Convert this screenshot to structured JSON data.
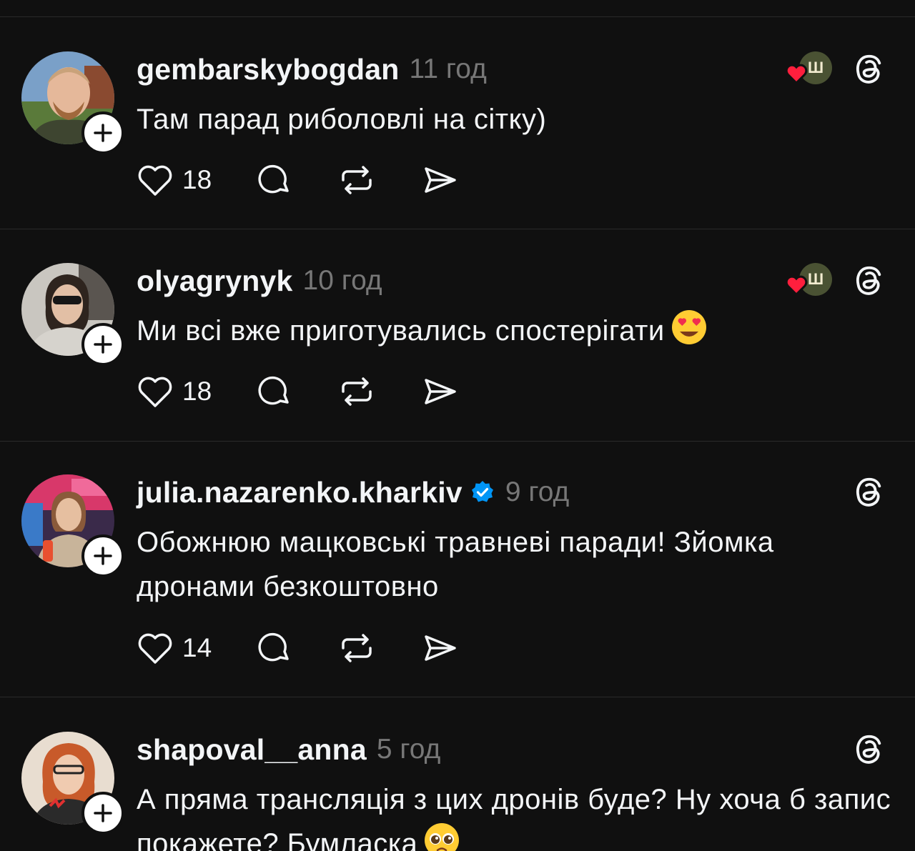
{
  "posts": [
    {
      "username": "gembarskybogdan",
      "time": "11 год",
      "text": "Там парад риболовлі на сітку)",
      "likes": "18",
      "verified": false,
      "liked_by_avatar": true,
      "liked_by_mark": "Ш"
    },
    {
      "username": "olyagrynyk",
      "time": "10 год",
      "text": "Ми всі вже приготувались спостерігати",
      "emoji": "heart-eyes",
      "likes": "18",
      "verified": false,
      "liked_by_avatar": true,
      "liked_by_mark": "Ш"
    },
    {
      "username": "julia.nazarenko.kharkiv",
      "time": "9 год",
      "text": "Обожнюю мацковські травневі паради! Зйомка дронами безкоштовно",
      "likes": "14",
      "verified": true,
      "liked_by_avatar": false
    },
    {
      "username": "shapoval__anna",
      "time": "5 год",
      "text": "А пряма трансляція з цих дронів буде? Ну хоча б запис покажете? Бумласка",
      "emoji": "pleading",
      "verified": false,
      "liked_by_avatar": false
    }
  ],
  "icons": {
    "like": "heart-outline-icon",
    "comment": "speech-bubble-icon",
    "repost": "repost-arrows-icon",
    "share": "paper-plane-icon",
    "threads": "threads-logo-icon",
    "follow": "plus-icon",
    "verified": "verified-badge-icon",
    "liked": "red-heart-icon"
  },
  "colors": {
    "background": "#101010",
    "text": "#f3f5f7",
    "muted": "#777777",
    "verified": "#0095f6",
    "liked_heart": "#ff1f3d"
  }
}
